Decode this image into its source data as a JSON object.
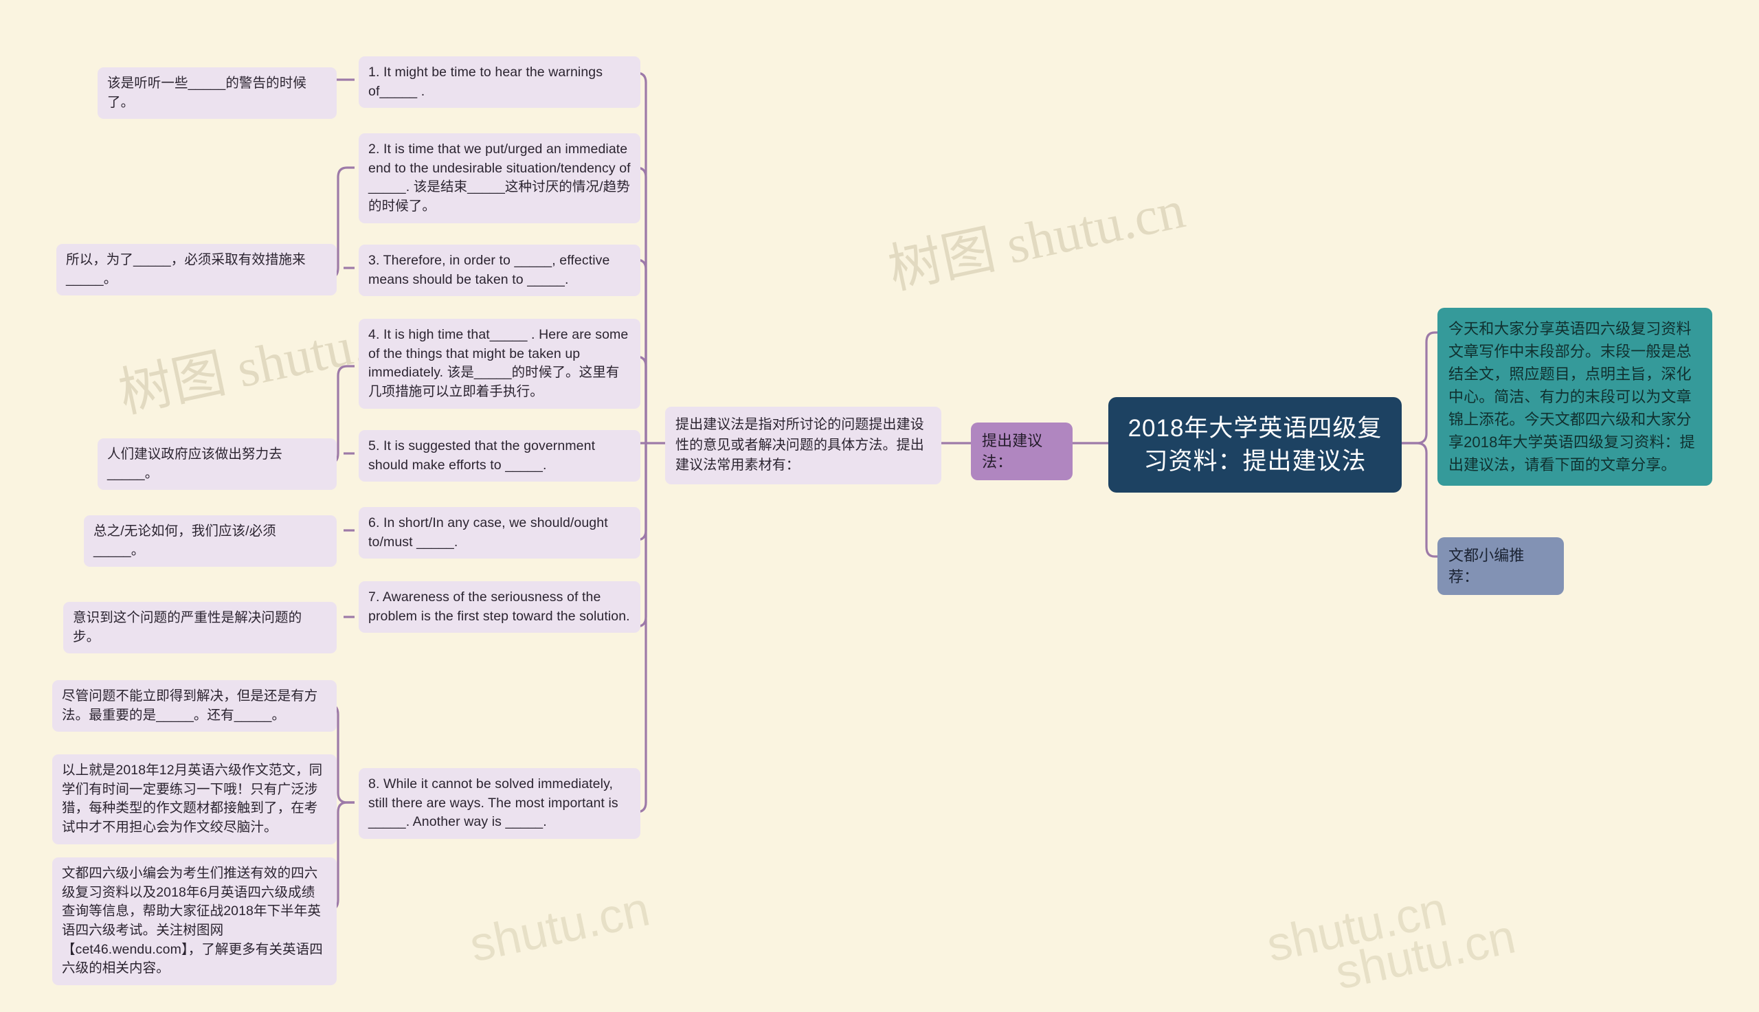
{
  "canvas": {
    "background_color": "#faf4e0",
    "link_color": "#9d7aa8",
    "watermarks": [
      "树图 shutu.cn",
      "树图 shutu.cn",
      "shutu.cn",
      "shutu.cn",
      "shutu.cn"
    ]
  },
  "root": {
    "title": "2018年大学英语四级复习资料：提出建议法",
    "color": "#1d4262"
  },
  "branch": {
    "label": "提出建议法：",
    "color": "#b086c0"
  },
  "description": {
    "text": "提出建议法是指对所讨论的问题提出建设性的意见或者解决问题的具体方法。提出建议法常用素材有："
  },
  "intro_panel": {
    "text": "今天和大家分享英语四六级复习资料文章写作中末段部分。末段一般是总结全文，照应题目，点明主旨，深化中心。简洁、有力的末段可以为文章锦上添花。今天文都四六级和大家分享2018年大学英语四级复习资料：提出建议法，请看下面的文章分享。",
    "color": "#359a9a"
  },
  "recommend_node": {
    "label": "文都小编推荐：",
    "color": "#8292b4"
  },
  "sentences": [
    {
      "id": 1,
      "text": "1. It might be time to hear the warnings of_____ ."
    },
    {
      "id": 2,
      "text": "2. It is time that we put/urged an immediate end to the undesirable situation/tendency of _____. 该是结束_____这种讨厌的情况/趋势的时候了。"
    },
    {
      "id": 3,
      "text": "3. Therefore, in order to _____, effective means should be taken to _____."
    },
    {
      "id": 4,
      "text": "4. It is high time that_____ . Here are some of the things that might be taken up immediately. 该是_____的时候了。这里有几项措施可以立即着手执行。"
    },
    {
      "id": 5,
      "text": "5. It is suggested that the government should make efforts to _____."
    },
    {
      "id": 6,
      "text": "6. In short/In any case, we should/ought to/must _____."
    },
    {
      "id": 7,
      "text": "7. Awareness of the seriousness of the problem is the first step toward the solution."
    },
    {
      "id": 8,
      "text": "8. While it cannot be solved immediately, still there are ways. The most important is _____. Another way is _____."
    }
  ],
  "translations": [
    {
      "id": 1,
      "text": "该是听听一些_____的警告的时候了。"
    },
    {
      "id": 2,
      "text": "所以，为了_____，必须采取有效措施来_____。"
    },
    {
      "id": 3,
      "text": "人们建议政府应该做出努力去_____。"
    },
    {
      "id": 4,
      "text": "总之/无论如何，我们应该/必须_____。"
    },
    {
      "id": 5,
      "text": "意识到这个问题的严重性是解决问题的步。"
    },
    {
      "id": 6,
      "text": "尽管问题不能立即得到解决，但是还是有方法。最重要的是_____。还有_____。"
    },
    {
      "id": 7,
      "text": "以上就是2018年12月英语六级作文范文，同学们有时间一定要练习一下哦！只有广泛涉猎，每种类型的作文题材都接触到了，在考试中才不用担心会为作文绞尽脑汁。"
    },
    {
      "id": 8,
      "text": "文都四六级小编会为考生们推送有效的四六级复习资料以及2018年6月英语四六级成绩查询等信息，帮助大家征战2018年下半年英语四六级考试。关注树图网【cet46.wendu.com】，了解更多有关英语四六级的相关内容。"
    }
  ]
}
